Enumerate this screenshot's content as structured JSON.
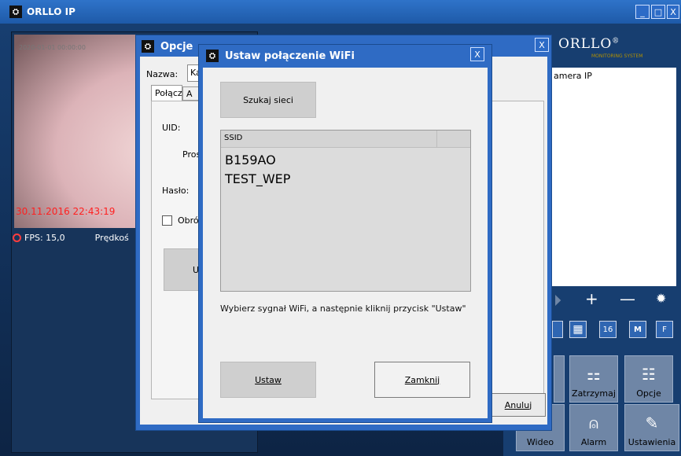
{
  "main_window": {
    "title": "ORLLO IP",
    "minimize": "_",
    "maximize": "□",
    "close": "X"
  },
  "video": {
    "timestamp_top": "2020-01-01 00:00:00",
    "timestamp": "30.11.2016 22:43:19",
    "fps": "FPS: 15,0",
    "speed_label": "Prędkoś"
  },
  "right_panel": {
    "logo": "ORLLO",
    "logo_reg": "®",
    "logo_sub": "MONITORING SYSTEM",
    "camera_list_item": "amera IP",
    "toolbar": {
      "plus": "+",
      "minus": "—",
      "settings": "✹",
      "next": "⏵"
    },
    "grid_buttons": [
      "▦",
      "16",
      "M",
      "F"
    ],
    "buttons": [
      {
        "label": "Zatrzymaj",
        "icon": "⚏"
      },
      {
        "label": "Opcje",
        "icon": "☷"
      },
      {
        "label": "Wideo",
        "icon": ""
      },
      {
        "label": "Alarm",
        "icon": "⍝"
      },
      {
        "label": "Ustawienia",
        "icon": "✎"
      }
    ]
  },
  "opcje_dialog": {
    "title": "Opcje",
    "close": "X",
    "name_label": "Nazwa:",
    "name_value": "Ka",
    "tabs": [
      "Połącz",
      "A"
    ],
    "uid_label": "UID:",
    "pros_label": "Pros",
    "haslo_label": "Hasło:",
    "obroc_label": "Obró",
    "button_u": "U",
    "cancel": "Anuluj"
  },
  "wifi_dialog": {
    "title": "Ustaw połączenie WiFi",
    "close": "X",
    "scan_button": "Szukaj sieci",
    "ssid_header": "SSID",
    "ssids": [
      "B159AO",
      "TEST_WEP"
    ],
    "hint": "Wybierz sygnał WiFi, a następnie kliknij przycisk \"Ustaw\"",
    "set_button": "Ustaw",
    "close_button": "Zamknij"
  }
}
